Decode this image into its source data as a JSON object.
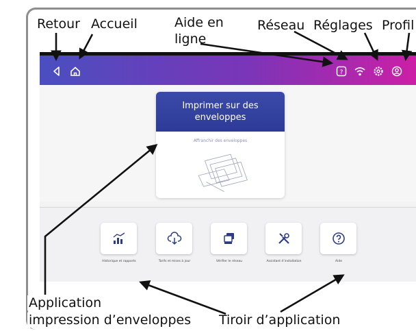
{
  "annotations": {
    "back": "Retour",
    "home": "Accueil",
    "help_line1": "Aide en",
    "help_line2": "ligne",
    "network": "Réseau",
    "settings": "Réglages",
    "profile": "Profil",
    "app_line1": "Application",
    "app_line2": "impression d’enveloppes",
    "drawer": "Tiroir d’application"
  },
  "topbar": {
    "icons": [
      "back-icon",
      "home-icon",
      "help-icon",
      "network-icon",
      "settings-icon",
      "profile-icon"
    ]
  },
  "main": {
    "card_title": "Imprimer sur des enveloppes",
    "card_subtitle": "Affranchir des enveloppes"
  },
  "drawer": {
    "tiles": [
      {
        "label": "Historique et rapports",
        "icon": "chart-icon"
      },
      {
        "label": "Tarifs et mises à jour",
        "icon": "cloud-download-icon"
      },
      {
        "label": "Vérifier le réseau",
        "icon": "layers-icon"
      },
      {
        "label": "Assistant d’installation",
        "icon": "tools-icon"
      },
      {
        "label": "Aide",
        "icon": "help-icon"
      }
    ]
  },
  "colors": {
    "topbar_start": "#4a4fc0",
    "topbar_end": "#cc1fa6",
    "card_header": "#3b4aa8",
    "icon_blue": "#2d3a8c"
  }
}
